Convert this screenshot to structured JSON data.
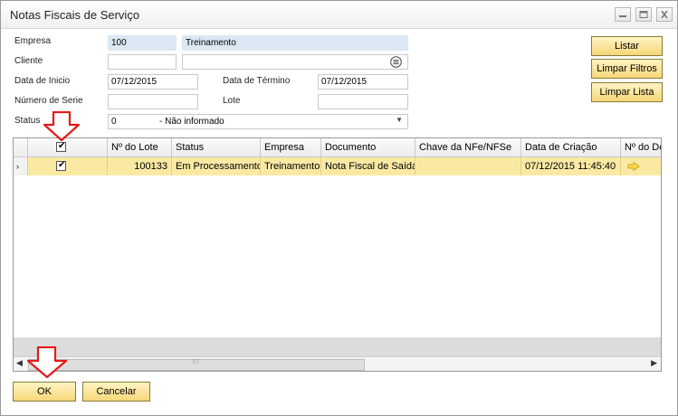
{
  "window": {
    "title": "Notas Fiscais de Serviço"
  },
  "form": {
    "empresa_label": "Empresa",
    "empresa_code": "100",
    "empresa_name": "Treinamento",
    "cliente_label": "Cliente",
    "cliente_code": "",
    "cliente_name": "",
    "data_inicio_label": "Data de Inicio",
    "data_inicio_value": "07/12/2015",
    "data_termino_label": "Data de Término",
    "data_termino_value": "07/12/2015",
    "numero_serie_label": "Número de Serie",
    "numero_serie_value": "",
    "lote_label": "Lote",
    "lote_value": "",
    "status_label": "Status",
    "status_code": "0",
    "status_text": "- Não informado"
  },
  "buttons": {
    "listar": "Listar",
    "limpar_filtros": "Limpar Filtros",
    "limpar_lista": "Limpar Lista",
    "ok": "OK",
    "cancelar": "Cancelar"
  },
  "grid": {
    "columns": [
      "Nº do Lote",
      "Status",
      "Empresa",
      "Documento",
      "Chave da NFe/NFSe",
      "Data de Criação",
      "Nº do Docu"
    ],
    "header_checked": true,
    "rows": [
      {
        "checked": true,
        "lote": "100133",
        "status": "Em Processamento",
        "empresa": "Treinamento",
        "documento": "Nota Fiscal de Saída",
        "chave": "",
        "data_criacao": "07/12/2015 11:45:40",
        "doc_icon": "arrow-link-icon"
      }
    ]
  },
  "colors": {
    "button_gradient_top": "#fff4c4",
    "button_gradient_bottom": "#f6d778",
    "selected_row": "#fae9a3",
    "readonly_field": "#dbe8f4",
    "annotation_arrow": "#e31b1b"
  }
}
